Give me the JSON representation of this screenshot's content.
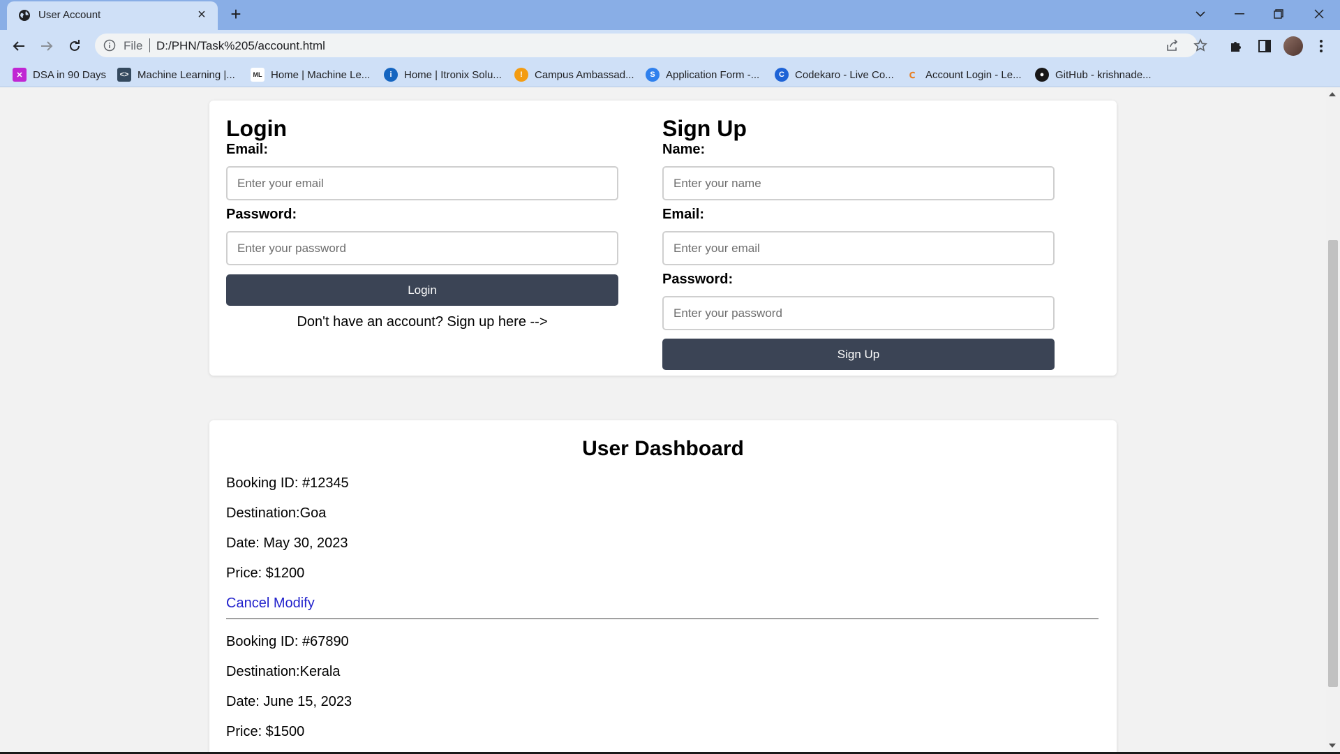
{
  "browser": {
    "tab_title": "User Account",
    "address_scheme": "File",
    "address_url": "D:/PHN/Task%205/account.html",
    "bookmarks": [
      {
        "label": "DSA in 90 Days",
        "color": "#c026d3",
        "icon": "grid-icon"
      },
      {
        "label": "Machine Learning  |...",
        "color": "#34495e",
        "icon": "code-icon"
      },
      {
        "label": "Home | Machine Le...",
        "color": "#222222",
        "icon": "ml-logo-icon"
      },
      {
        "label": "Home | Itronix Solu...",
        "color": "#1565c0",
        "icon": "itronix-logo-icon"
      },
      {
        "label": "Campus Ambassad...",
        "color": "#f39c12",
        "icon": "campus-logo-icon"
      },
      {
        "label": "Application Form -...",
        "color": "#2f80ed",
        "icon": "s-logo-icon"
      },
      {
        "label": "Codekaro - Live Co...",
        "color": "#1e63d6",
        "icon": "c-logo-icon"
      },
      {
        "label": "Account Login - Le...",
        "color": "#e67e22",
        "icon": "leetcode-logo-icon"
      },
      {
        "label": "GitHub - krishnade...",
        "color": "#181717",
        "icon": "github-icon"
      }
    ]
  },
  "login": {
    "title": "Login",
    "email_label": "Email:",
    "email_placeholder": "Enter your email",
    "password_label": "Password:",
    "password_placeholder": "Enter your password",
    "button_label": "Login",
    "signup_prompt": "Don't have an account? Sign up here -->"
  },
  "signup": {
    "title": "Sign Up",
    "name_label": "Name:",
    "name_placeholder": "Enter your name",
    "email_label": "Email:",
    "email_placeholder": "Enter your email",
    "password_label": "Password:",
    "password_placeholder": "Enter your password",
    "button_label": "Sign Up"
  },
  "dashboard": {
    "title": "User Dashboard",
    "bookings": [
      {
        "booking_id": "Booking ID: #12345",
        "destination": "Destination:Goa",
        "date": "Date: May 30, 2023",
        "price": "Price: $1200",
        "cancel_label": "Cancel",
        "modify_label": "Modify"
      },
      {
        "booking_id": "Booking ID: #67890",
        "destination": "Destination:Kerala",
        "date": "Date: June 15, 2023",
        "price": "Price: $1500"
      }
    ]
  },
  "colors": {
    "button_bg": "#3b4455",
    "link": "#2222cc",
    "chrome_tabstrip": "#89aee6",
    "chrome_toolbar": "#cfe0f7"
  }
}
